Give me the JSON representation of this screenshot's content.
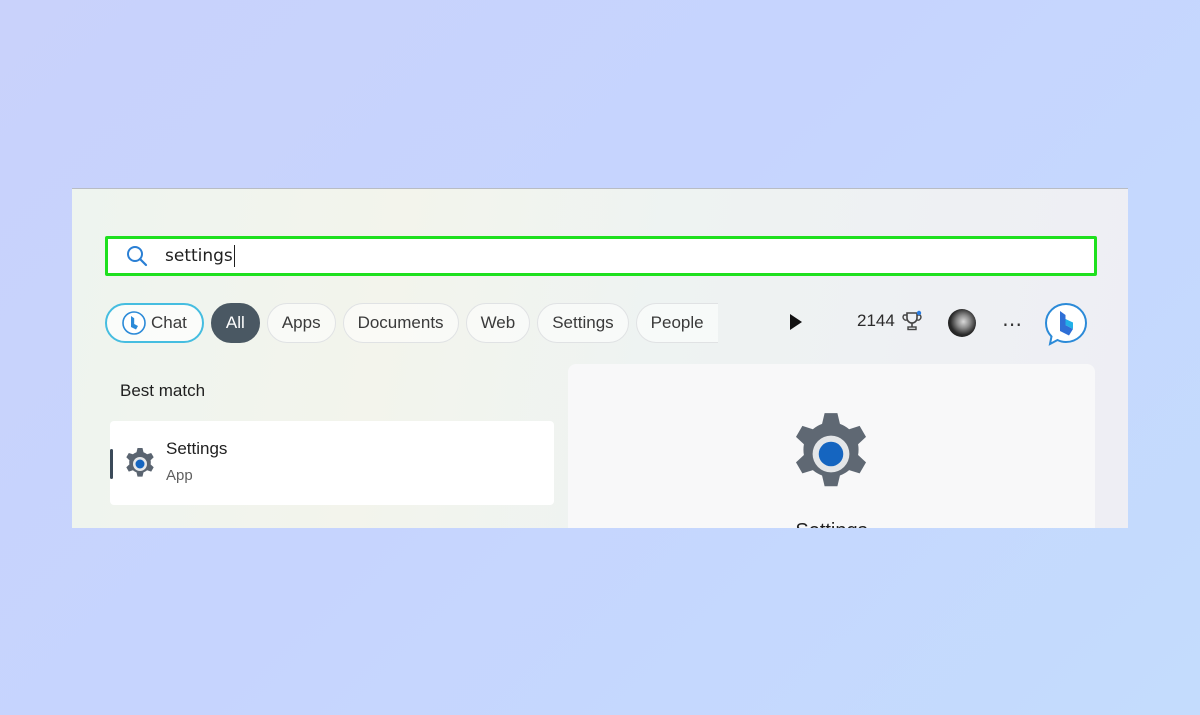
{
  "search": {
    "query": "settings"
  },
  "filters": {
    "chat": "Chat",
    "items": [
      "All",
      "Apps",
      "Documents",
      "Web",
      "Settings",
      "People"
    ]
  },
  "rewards": {
    "points": "2144"
  },
  "results": {
    "section_label": "Best match",
    "best": {
      "title": "Settings",
      "subtitle": "App"
    }
  },
  "detail": {
    "title": "Settings"
  },
  "icons": {
    "search": "search-icon",
    "play": "play-icon",
    "trophy": "trophy-icon",
    "more": "more-icon",
    "bing": "bing-icon",
    "settings": "settings-gear-icon"
  },
  "colors": {
    "highlight_border": "#1ee01e",
    "active_chip": "#4a5863",
    "chat_border": "#45bde0",
    "gear_center": "#1565c0"
  }
}
